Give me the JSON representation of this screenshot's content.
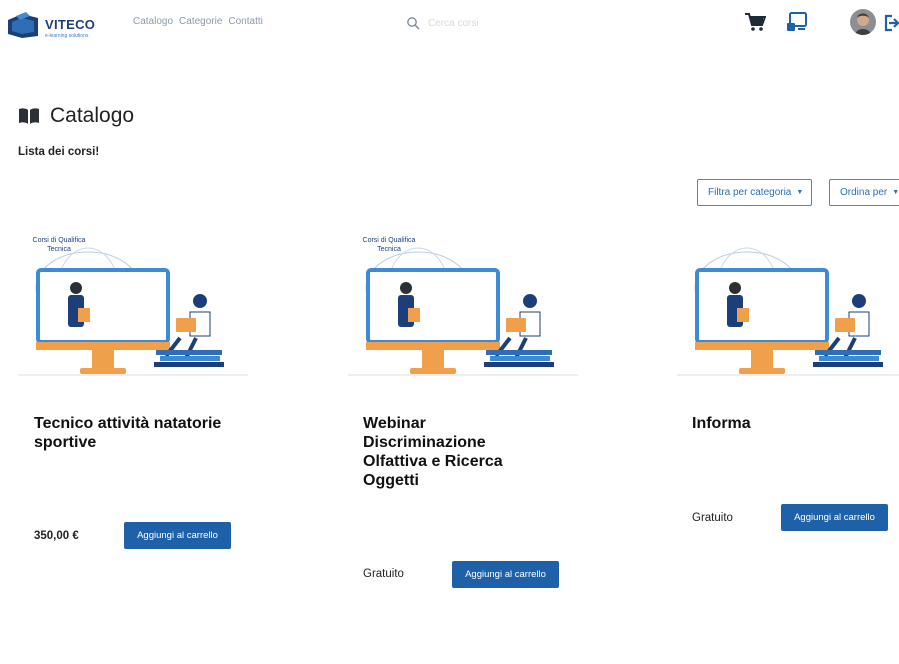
{
  "header": {
    "logo_text": "VITECO",
    "logo_tagline": "e-learning solutions",
    "nav": [
      {
        "label": "Catalogo"
      },
      {
        "label": "Categorie"
      },
      {
        "label": "Contatti"
      }
    ],
    "search_placeholder": "Cerca corsi",
    "icons": {
      "cart": "cart-icon",
      "cast": "cast-icon",
      "avatar": "avatar",
      "logout": "logout-icon"
    }
  },
  "page": {
    "title": "Catalogo",
    "title_icon": "book-open-icon",
    "subtitle": "Lista dei corsi!"
  },
  "filters": {
    "category_label": "Filtra per categoria",
    "sort_label": "Ordina per"
  },
  "courses": [
    {
      "thumb_caption": "Corsi di Qualifica Tecnica",
      "title": "Tecnico attività natatorie sportive",
      "price": "350,00 €",
      "button": "Aggiungi al carrello"
    },
    {
      "thumb_caption": "Corsi di Qualifica Tecnica",
      "title": "Webinar Discriminazione Olfattiva e Ricerca Oggetti",
      "price": "Gratuito",
      "button": "Aggiungi al carrello"
    },
    {
      "thumb_caption": "",
      "title": "Informa",
      "price": "Gratuito",
      "button": "Aggiungi al carrello"
    }
  ],
  "colors": {
    "primary": "#1f61a8",
    "brand": "#1c3f7a",
    "accent": "#3d8bd4",
    "monitor_base": "#f0a04b"
  }
}
